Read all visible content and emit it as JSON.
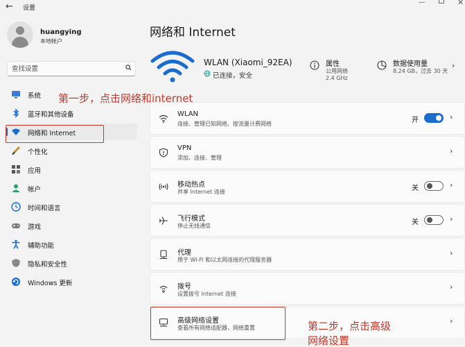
{
  "window": {
    "title": "设置",
    "back_glyph": "←",
    "minimize_glyph": "—",
    "close_glyph": "✕"
  },
  "user": {
    "name": "huangying",
    "account_type": "本地帐户"
  },
  "search": {
    "placeholder": "查找设置"
  },
  "sidebar": {
    "active_index": 2,
    "items": [
      {
        "label": "系统",
        "icon": "monitor-icon"
      },
      {
        "label": "蓝牙和其他设备",
        "icon": "bluetooth-icon"
      },
      {
        "label": "网络和 Internet",
        "icon": "wifi-icon"
      },
      {
        "label": "个性化",
        "icon": "brush-icon"
      },
      {
        "label": "应用",
        "icon": "apps-icon"
      },
      {
        "label": "帐户",
        "icon": "person-icon"
      },
      {
        "label": "时间和语言",
        "icon": "clock-globe-icon"
      },
      {
        "label": "游戏",
        "icon": "gamepad-icon"
      },
      {
        "label": "辅助功能",
        "icon": "accessibility-icon"
      },
      {
        "label": "隐私和安全性",
        "icon": "shield-icon"
      },
      {
        "label": "Windows 更新",
        "icon": "update-icon"
      }
    ]
  },
  "main": {
    "title": "网络和 Internet",
    "connection": {
      "ssid": "WLAN (Xiaomi_92EA)",
      "status": "已连接，安全"
    },
    "properties": {
      "title": "属性",
      "network_type": "公用网络",
      "band": "2.4 GHz"
    },
    "data_usage": {
      "title": "数据使用量",
      "detail": "8.24 GB，过去 30 天"
    },
    "chevron_glyph": "›",
    "cards": [
      {
        "title": "WLAN",
        "subtitle": "连接、管理已知网络、按流量计费网络",
        "icon": "wifi-icon",
        "toggle_label": "开",
        "toggle_state": "on"
      },
      {
        "title": "VPN",
        "subtitle": "添加、连接、管理",
        "icon": "vpn-shield-icon"
      },
      {
        "title": "移动热点",
        "subtitle": "共享 Internet 连接",
        "icon": "hotspot-icon",
        "toggle_label": "关",
        "toggle_state": "off"
      },
      {
        "title": "飞行模式",
        "subtitle": "停止无线通信",
        "icon": "airplane-icon",
        "toggle_label": "关",
        "toggle_state": "off"
      },
      {
        "title": "代理",
        "subtitle": "用于 Wi-Fi 和以太网连接的代理服务器",
        "icon": "proxy-icon"
      },
      {
        "title": "拨号",
        "subtitle": "设置拨号 Internet 连接",
        "icon": "dialup-icon"
      },
      {
        "title": "高级网络设置",
        "subtitle": "查看所有网络适配器，网络重置",
        "icon": "advanced-network-icon"
      }
    ]
  },
  "annotations": {
    "step1": "第一步，点击网络和internet",
    "step2_line1": "第二步，点击高级",
    "step2_line2": "网络设置",
    "color": "#c0392b"
  },
  "colors": {
    "accent": "#1a6ccf",
    "background": "#f3f3f3",
    "card": "#fbfbfb",
    "annotation": "#c0392b"
  }
}
